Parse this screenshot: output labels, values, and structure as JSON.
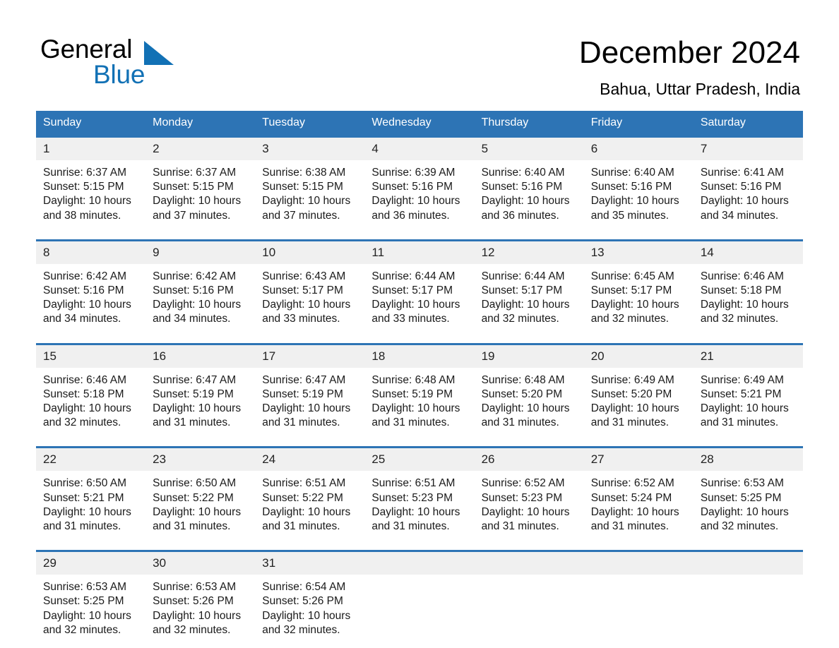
{
  "brand": {
    "name_part1": "General",
    "name_part2": "Blue",
    "triangle_icon": "triangle-icon",
    "accent_color": "#1271b5"
  },
  "header": {
    "month_title": "December 2024",
    "location": "Bahua, Uttar Pradesh, India"
  },
  "calendar": {
    "header_bg_color": "#2d74b5",
    "daynum_bg_color": "#f0f0f0",
    "weekday_headers": [
      "Sunday",
      "Monday",
      "Tuesday",
      "Wednesday",
      "Thursday",
      "Friday",
      "Saturday"
    ],
    "weeks": [
      [
        {
          "day": "1",
          "sunrise": "Sunrise: 6:37 AM",
          "sunset": "Sunset: 5:15 PM",
          "daylight": "Daylight: 10 hours and 38 minutes."
        },
        {
          "day": "2",
          "sunrise": "Sunrise: 6:37 AM",
          "sunset": "Sunset: 5:15 PM",
          "daylight": "Daylight: 10 hours and 37 minutes."
        },
        {
          "day": "3",
          "sunrise": "Sunrise: 6:38 AM",
          "sunset": "Sunset: 5:15 PM",
          "daylight": "Daylight: 10 hours and 37 minutes."
        },
        {
          "day": "4",
          "sunrise": "Sunrise: 6:39 AM",
          "sunset": "Sunset: 5:16 PM",
          "daylight": "Daylight: 10 hours and 36 minutes."
        },
        {
          "day": "5",
          "sunrise": "Sunrise: 6:40 AM",
          "sunset": "Sunset: 5:16 PM",
          "daylight": "Daylight: 10 hours and 36 minutes."
        },
        {
          "day": "6",
          "sunrise": "Sunrise: 6:40 AM",
          "sunset": "Sunset: 5:16 PM",
          "daylight": "Daylight: 10 hours and 35 minutes."
        },
        {
          "day": "7",
          "sunrise": "Sunrise: 6:41 AM",
          "sunset": "Sunset: 5:16 PM",
          "daylight": "Daylight: 10 hours and 34 minutes."
        }
      ],
      [
        {
          "day": "8",
          "sunrise": "Sunrise: 6:42 AM",
          "sunset": "Sunset: 5:16 PM",
          "daylight": "Daylight: 10 hours and 34 minutes."
        },
        {
          "day": "9",
          "sunrise": "Sunrise: 6:42 AM",
          "sunset": "Sunset: 5:16 PM",
          "daylight": "Daylight: 10 hours and 34 minutes."
        },
        {
          "day": "10",
          "sunrise": "Sunrise: 6:43 AM",
          "sunset": "Sunset: 5:17 PM",
          "daylight": "Daylight: 10 hours and 33 minutes."
        },
        {
          "day": "11",
          "sunrise": "Sunrise: 6:44 AM",
          "sunset": "Sunset: 5:17 PM",
          "daylight": "Daylight: 10 hours and 33 minutes."
        },
        {
          "day": "12",
          "sunrise": "Sunrise: 6:44 AM",
          "sunset": "Sunset: 5:17 PM",
          "daylight": "Daylight: 10 hours and 32 minutes."
        },
        {
          "day": "13",
          "sunrise": "Sunrise: 6:45 AM",
          "sunset": "Sunset: 5:17 PM",
          "daylight": "Daylight: 10 hours and 32 minutes."
        },
        {
          "day": "14",
          "sunrise": "Sunrise: 6:46 AM",
          "sunset": "Sunset: 5:18 PM",
          "daylight": "Daylight: 10 hours and 32 minutes."
        }
      ],
      [
        {
          "day": "15",
          "sunrise": "Sunrise: 6:46 AM",
          "sunset": "Sunset: 5:18 PM",
          "daylight": "Daylight: 10 hours and 32 minutes."
        },
        {
          "day": "16",
          "sunrise": "Sunrise: 6:47 AM",
          "sunset": "Sunset: 5:19 PM",
          "daylight": "Daylight: 10 hours and 31 minutes."
        },
        {
          "day": "17",
          "sunrise": "Sunrise: 6:47 AM",
          "sunset": "Sunset: 5:19 PM",
          "daylight": "Daylight: 10 hours and 31 minutes."
        },
        {
          "day": "18",
          "sunrise": "Sunrise: 6:48 AM",
          "sunset": "Sunset: 5:19 PM",
          "daylight": "Daylight: 10 hours and 31 minutes."
        },
        {
          "day": "19",
          "sunrise": "Sunrise: 6:48 AM",
          "sunset": "Sunset: 5:20 PM",
          "daylight": "Daylight: 10 hours and 31 minutes."
        },
        {
          "day": "20",
          "sunrise": "Sunrise: 6:49 AM",
          "sunset": "Sunset: 5:20 PM",
          "daylight": "Daylight: 10 hours and 31 minutes."
        },
        {
          "day": "21",
          "sunrise": "Sunrise: 6:49 AM",
          "sunset": "Sunset: 5:21 PM",
          "daylight": "Daylight: 10 hours and 31 minutes."
        }
      ],
      [
        {
          "day": "22",
          "sunrise": "Sunrise: 6:50 AM",
          "sunset": "Sunset: 5:21 PM",
          "daylight": "Daylight: 10 hours and 31 minutes."
        },
        {
          "day": "23",
          "sunrise": "Sunrise: 6:50 AM",
          "sunset": "Sunset: 5:22 PM",
          "daylight": "Daylight: 10 hours and 31 minutes."
        },
        {
          "day": "24",
          "sunrise": "Sunrise: 6:51 AM",
          "sunset": "Sunset: 5:22 PM",
          "daylight": "Daylight: 10 hours and 31 minutes."
        },
        {
          "day": "25",
          "sunrise": "Sunrise: 6:51 AM",
          "sunset": "Sunset: 5:23 PM",
          "daylight": "Daylight: 10 hours and 31 minutes."
        },
        {
          "day": "26",
          "sunrise": "Sunrise: 6:52 AM",
          "sunset": "Sunset: 5:23 PM",
          "daylight": "Daylight: 10 hours and 31 minutes."
        },
        {
          "day": "27",
          "sunrise": "Sunrise: 6:52 AM",
          "sunset": "Sunset: 5:24 PM",
          "daylight": "Daylight: 10 hours and 31 minutes."
        },
        {
          "day": "28",
          "sunrise": "Sunrise: 6:53 AM",
          "sunset": "Sunset: 5:25 PM",
          "daylight": "Daylight: 10 hours and 32 minutes."
        }
      ],
      [
        {
          "day": "29",
          "sunrise": "Sunrise: 6:53 AM",
          "sunset": "Sunset: 5:25 PM",
          "daylight": "Daylight: 10 hours and 32 minutes."
        },
        {
          "day": "30",
          "sunrise": "Sunrise: 6:53 AM",
          "sunset": "Sunset: 5:26 PM",
          "daylight": "Daylight: 10 hours and 32 minutes."
        },
        {
          "day": "31",
          "sunrise": "Sunrise: 6:54 AM",
          "sunset": "Sunset: 5:26 PM",
          "daylight": "Daylight: 10 hours and 32 minutes."
        },
        {
          "day": "",
          "sunrise": "",
          "sunset": "",
          "daylight": ""
        },
        {
          "day": "",
          "sunrise": "",
          "sunset": "",
          "daylight": ""
        },
        {
          "day": "",
          "sunrise": "",
          "sunset": "",
          "daylight": ""
        },
        {
          "day": "",
          "sunrise": "",
          "sunset": "",
          "daylight": ""
        }
      ]
    ]
  }
}
